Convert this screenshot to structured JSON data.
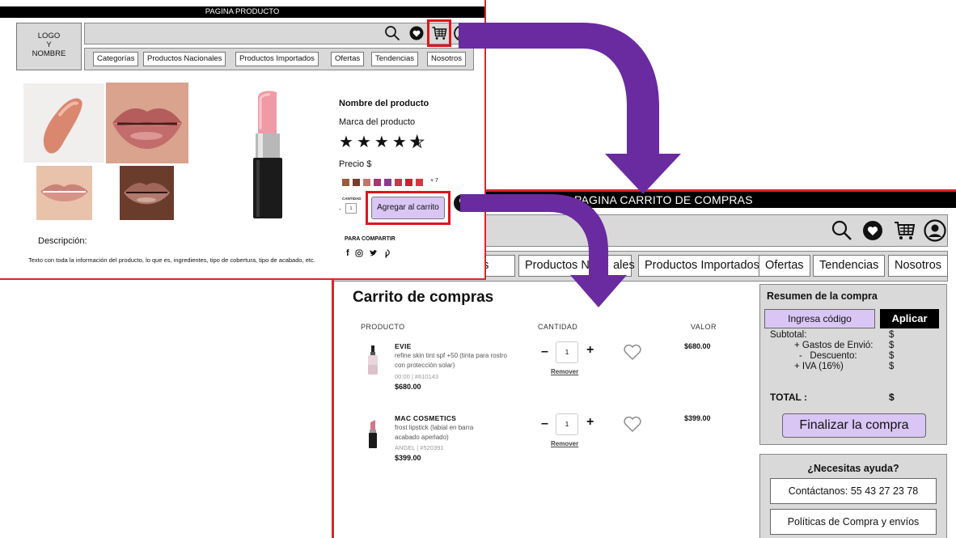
{
  "product_page": {
    "title": "PAGINA PRODUCTO",
    "logo_lines": [
      "LOGO",
      "Y",
      "NOMBRE"
    ],
    "nav": [
      "Categorías",
      "Productos Nacionales",
      "Productos Importados",
      "Ofertas",
      "Tendencias",
      "Nosotros"
    ],
    "product_name": "Nombre del producto",
    "product_brand": "Marca del producto",
    "rating_stars": 4.5,
    "price_label": "Precio $",
    "swatch_colors": [
      "#9a5a3e",
      "#7b3b2a",
      "#c2766a",
      "#a63770",
      "#8a3a8c",
      "#c23a4a",
      "#d0202f",
      "#d9353f"
    ],
    "more_colors": "+ 7",
    "quantity_label": "CANTIDAD",
    "quantity_value": "1",
    "add_to_cart": "Agregar al carrito",
    "share_label": "PARA COMPARTIR",
    "description_title": "Descripción:",
    "description_text": "Texto con toda la información del producto, lo que es, ingredientes, tipo de cobertura, tipo de acabado, etc."
  },
  "cart_page": {
    "title": "PAGINA CARRITO DE COMPRAS",
    "nav": [
      "ías",
      "Productos Nac",
      "ales",
      "Productos Importados",
      "Ofertas",
      "Tendencias",
      "Nosotros"
    ],
    "heading": "Carrito de compras",
    "columns": {
      "product": "PRODUCTO",
      "quantity": "CANTIDAD",
      "value": "VALOR"
    },
    "items": [
      {
        "brand": "EVIE",
        "desc": "refine skin tint spf +50 (tinta para rostro con protección solar)",
        "shade": "00:00",
        "sku": "#610143",
        "price": "$680.00",
        "qty": "1",
        "remove": "Remover",
        "value": "$680.00"
      },
      {
        "brand": "MAC COSMETICS",
        "desc": "frost lipstick (labial en barra acabado aperlado)",
        "shade": "ANGEL",
        "sku": "#520391",
        "price": "$399.00",
        "qty": "1",
        "remove": "Remover",
        "value": "$399.00"
      }
    ],
    "summary": {
      "title": "Resumen de la compra",
      "code_button": "Ingresa código",
      "apply_button": "Aplicar",
      "subtotal": "Subtotal:",
      "shipping": "+ Gastos de Envió:",
      "discount": "-   Descuento:",
      "iva": "+ IVA (16%)",
      "currency": "$",
      "total": "TOTAL :",
      "checkout": "Finalizar la compra"
    },
    "help": {
      "title": "¿Necesitas ayuda?",
      "contact": "Contáctanos: 55 43 27 23 78",
      "policies": "Políticas de Compra y envíos"
    }
  },
  "colors": {
    "highlight": "#e0141e",
    "arrow": "#6a2aa0",
    "button_lavender": "#d9c6f5",
    "panel_gray": "#d9d9d9"
  }
}
